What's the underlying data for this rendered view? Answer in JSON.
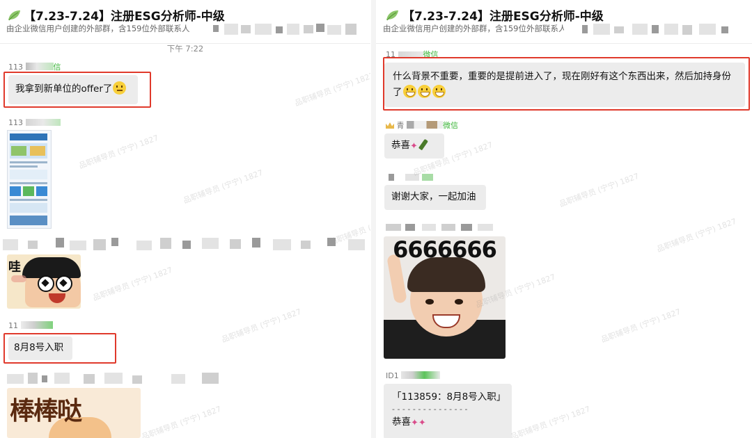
{
  "chat": {
    "title": "【7.23-7.24】注册ESG分析师-中级",
    "subtitle": "由企业微信用户创建的外部群，含159位外部联系人",
    "subtitle_cut": "由企业微信用户创建的外部群，含159位外部联系人",
    "time_divider": "下午 7:22"
  },
  "left_messages": {
    "m1_sender": "113",
    "m1_sender_suffix": "信",
    "m1_text": "我拿到新单位的offer了",
    "m2_sender": "113",
    "m3_sticker_text": "哇",
    "m4_sender": "11",
    "m4_text": "8月8号入职",
    "m5_sticker_text": "棒棒哒"
  },
  "right_messages": {
    "r1_sender": "11",
    "r1_sender_suffix": "微信",
    "r1_text_line1": "什么背景不重要，重要的是提前进入了，现在刚好有这个东西出来，然后加持身份",
    "r1_text_line2": "了",
    "r2_sender_prefix": "青",
    "r2_sender_suffix": "微信",
    "r2_text": "恭喜",
    "r3_text": "谢谢大家，一起加油",
    "r4_sticker_text": "6666666",
    "r5_sender": "ID1",
    "r5_quote": "「113859：8月8号入职」",
    "r5_separator": "- - - - - - - - - - - - - - -",
    "r5_text": "恭喜"
  },
  "watermark": "品职辅导员 (宁宁) 1827",
  "colors": {
    "highlight_red": "#e0392b",
    "bubble_gray": "#ececec",
    "wechat_green": "#3db53a"
  },
  "icons": [
    "leaf-icon",
    "thinking-emoji-icon",
    "grin-emoji-icon",
    "party-popper-icon",
    "champagne-icon",
    "crown-icon"
  ]
}
